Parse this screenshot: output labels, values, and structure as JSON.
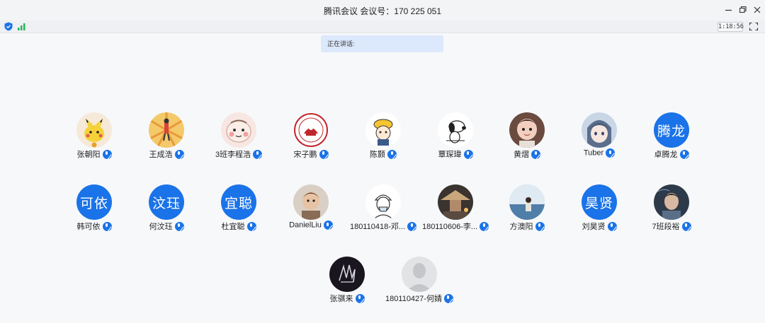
{
  "window": {
    "title": "腾讯会议 会议号：170 225 051"
  },
  "toolbar": {
    "timer": "1:18:56",
    "icons": [
      "shield-icon",
      "signal-icon",
      "fullscreen-icon"
    ]
  },
  "speaking": {
    "label": "正在讲话:"
  },
  "colors": {
    "accent": "#1a73e8",
    "speaking_bg": "#dce8fb"
  },
  "participants": [
    {
      "name": "张朝阳",
      "avatar": "pikachu-avatar"
    },
    {
      "name": "王成浩",
      "avatar": "sunburst-avatar"
    },
    {
      "name": "3班李程浩",
      "avatar": "cartoon-face-avatar"
    },
    {
      "name": "宋子鹏",
      "avatar": "seal-avatar"
    },
    {
      "name": "陈颢",
      "avatar": "yellow-hat-avatar"
    },
    {
      "name": "覃琛瑋",
      "avatar": "snoopy-avatar"
    },
    {
      "name": "黄熠",
      "avatar": "baby-photo-avatar"
    },
    {
      "name": "Tuber",
      "avatar": "anime-avatar"
    },
    {
      "name": "卓腾龙",
      "avatar_text": "腾龙"
    },
    {
      "name": "韩可依",
      "avatar_text": "可依"
    },
    {
      "name": "何汶珏",
      "avatar_text": "汶珏"
    },
    {
      "name": "杜宜聪",
      "avatar_text": "宜聪"
    },
    {
      "name": "DanielLiu",
      "avatar": "child-photo-avatar"
    },
    {
      "name": "180110418-邓...",
      "avatar": "sketch-avatar"
    },
    {
      "name": "180110606-李...",
      "avatar": "straw-hat-avatar"
    },
    {
      "name": "方澳阳",
      "avatar": "sea-photo-avatar"
    },
    {
      "name": "刘昊贤",
      "avatar_text": "昊贤"
    },
    {
      "name": "7班段裕",
      "avatar": "portrait-avatar"
    },
    {
      "name": "张骐来",
      "avatar": "dark-art-avatar"
    },
    {
      "name": "180110427-何婧",
      "avatar": "default-person-avatar"
    }
  ]
}
